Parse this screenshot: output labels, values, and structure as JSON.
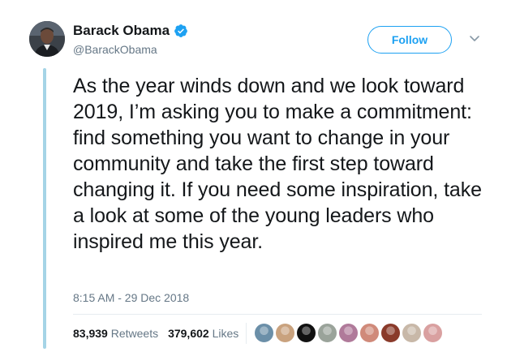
{
  "author": {
    "display_name": "Barack Obama",
    "handle": "@BarackObama",
    "verified": true,
    "avatar_icon": "profile-photo"
  },
  "follow_button": {
    "label": "Follow"
  },
  "menu_icon": "chevron-down-icon",
  "tweet": {
    "text": "As the year winds down and we look toward 2019, I’m asking you to make a commitment: find something you want to change in your community and take the first step toward changing it. If you need some inspiration, take a look at some of the young leaders who inspired me this year.",
    "timestamp": "8:15 AM - 29 Dec 2018"
  },
  "stats": {
    "retweets_count": "83,939",
    "retweets_label": "Retweets",
    "likes_count": "379,602",
    "likes_label": "Likes"
  },
  "colors": {
    "brand_blue": "#1da1f2",
    "muted_text": "#657786",
    "thread_line": "#a5d4e6",
    "verified_blue": "#1da1f2"
  },
  "liker_avatars": [
    {
      "name": "liker-avatar-1",
      "color": "#6b8fa8"
    },
    {
      "name": "liker-avatar-2",
      "color": "#c9a27e"
    },
    {
      "name": "liker-avatar-3",
      "color": "#111111"
    },
    {
      "name": "liker-avatar-4",
      "color": "#9aa39a"
    },
    {
      "name": "liker-avatar-5",
      "color": "#b07a9a"
    },
    {
      "name": "liker-avatar-6",
      "color": "#d08a7a"
    },
    {
      "name": "liker-avatar-7",
      "color": "#8a3a2a"
    },
    {
      "name": "liker-avatar-8",
      "color": "#c8b8a8"
    },
    {
      "name": "liker-avatar-9",
      "color": "#d9a0a0"
    }
  ]
}
